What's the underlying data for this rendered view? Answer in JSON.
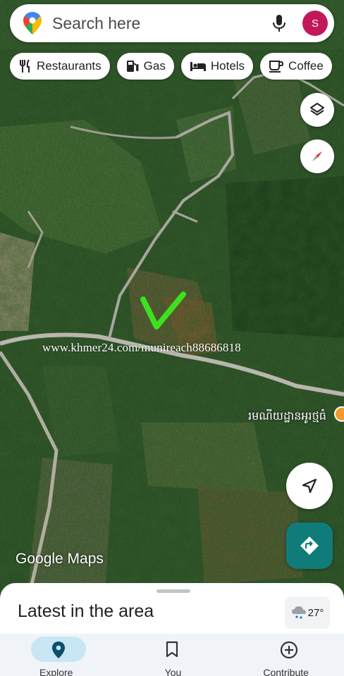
{
  "search": {
    "placeholder": "Search here",
    "avatar_letter": "S",
    "avatar_color": "#c2185b"
  },
  "chips": [
    {
      "label": "Restaurants",
      "icon": "fork-knife-icon"
    },
    {
      "label": "Gas",
      "icon": "gas-pump-icon"
    },
    {
      "label": "Hotels",
      "icon": "bed-icon"
    },
    {
      "label": "Coffee",
      "icon": "coffee-cup-icon"
    }
  ],
  "map": {
    "watermark": "www.khmer24.com/munireach88686818",
    "place_label": "រមណីយដ្ឋានអូរថ្មធំ",
    "brand": "Google Maps",
    "marker_color": "#3ee020"
  },
  "buttons": {
    "layers": "layers-icon",
    "compass": "compass-icon",
    "locate": "navigation-arrow-icon",
    "directions": "directions-icon",
    "directions_color": "#0f7c7a"
  },
  "sheet": {
    "title": "Latest in the area",
    "temperature": "27°"
  },
  "nav": {
    "items": [
      {
        "label": "Explore",
        "icon": "location-pin-icon",
        "active": true
      },
      {
        "label": "You",
        "icon": "bookmark-icon",
        "active": false
      },
      {
        "label": "Contribute",
        "icon": "add-circle-icon",
        "active": false
      }
    ]
  }
}
